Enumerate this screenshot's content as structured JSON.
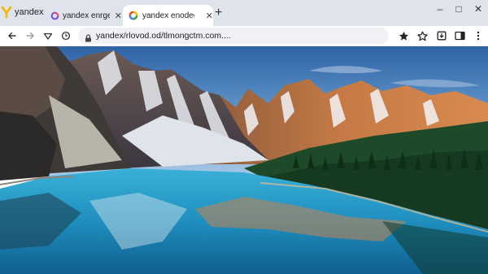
{
  "browser": {
    "brand_label": "yandex",
    "tabs": [
      {
        "title": "yandex enrgery.eln",
        "active": false
      },
      {
        "title": "yandex enodece",
        "active": true
      }
    ],
    "new_tab": "+",
    "window_controls": {
      "minimize": "–",
      "maximize": "□",
      "close": "✕"
    }
  },
  "toolbar": {
    "url": "yandex/rlovod.od/tlmongctm.com...."
  },
  "colors": {
    "tabbar_bg": "#dfe3eb",
    "active_tab_bg": "#ffffff",
    "omnibox_bg": "#eff1f5",
    "brand_yellow": "#f5b800",
    "sky": "#4f86bf",
    "lake": "#1f8fbf"
  }
}
